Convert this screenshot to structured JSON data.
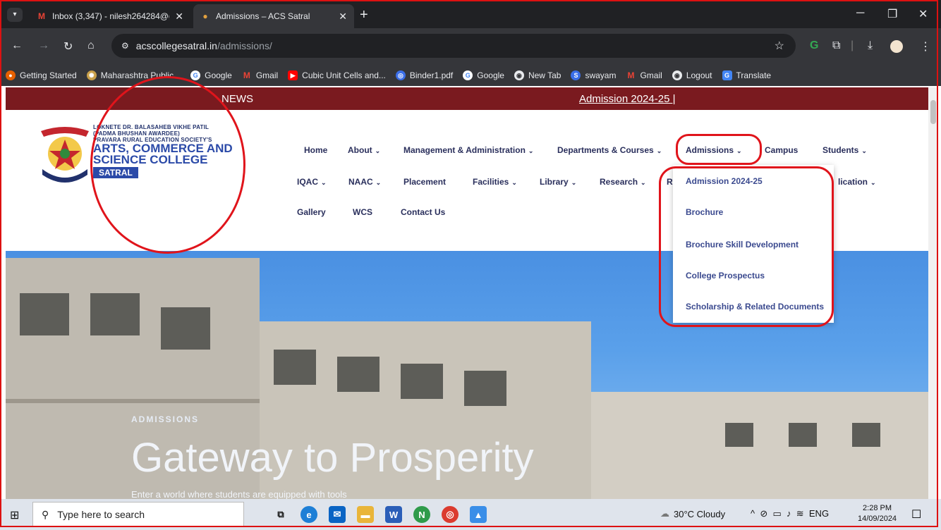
{
  "browser": {
    "tabs": [
      {
        "title": "Inbox (3,347) - nilesh264284@g",
        "icon": "gmail-icon"
      },
      {
        "title": "Admissions – ACS Satral",
        "icon": "college-favicon"
      }
    ],
    "url_host": "acscollegesatral.in",
    "url_path": "/admissions/",
    "bookmarks": [
      "Getting Started",
      "Maharashtra Public...",
      "Google",
      "Gmail",
      "Cubic Unit Cells and...",
      "Binder1.pdf",
      "Google",
      "New Tab",
      "swayam",
      "Gmail",
      "Logout",
      "Translate"
    ]
  },
  "site": {
    "news_label": "NEWS",
    "news_ticker": "Admission 2024-25 |",
    "logo_lines": [
      "LOKNETE DR. BALASAHEB VIKHE PATIL",
      "(PADMA BHUSHAN AWARDEE)",
      "PRAVARA RURAL EDUCATION SOCIETY'S"
    ],
    "logo_title_1": "ARTS, COMMERCE AND",
    "logo_title_2": "SCIENCE COLLEGE",
    "logo_badge": "SATRAL",
    "menu_row1": [
      "Home",
      "About",
      "Management & Administration",
      "Departments & Courses",
      "Admissions",
      "Campus",
      "Students"
    ],
    "menu_row2": [
      "IQAC",
      "NAAC",
      "Placement",
      "Facilities",
      "Library",
      "Research",
      "R",
      "lication"
    ],
    "menu_row3": [
      "Gallery",
      "WCS",
      "Contact Us"
    ],
    "dropdown": [
      "Admission 2024-25",
      "Brochure",
      "Brochure Skill Development",
      "College Prospectus",
      "Scholarship & Related Documents"
    ],
    "hero_sub": "ADMISSIONS",
    "hero_title": "Gateway to Prosperity",
    "hero_desc": "Enter a world where students are equipped with tools"
  },
  "taskbar": {
    "search_placeholder": "Type here to search",
    "weather": "30°C  Cloudy",
    "lang": "ENG",
    "time": "2:28 PM",
    "date": "14/09/2024"
  },
  "colors": {
    "news_bar": "#7a1a1f",
    "menu_text": "#2a2f5c",
    "annotation": "#e0141b"
  }
}
